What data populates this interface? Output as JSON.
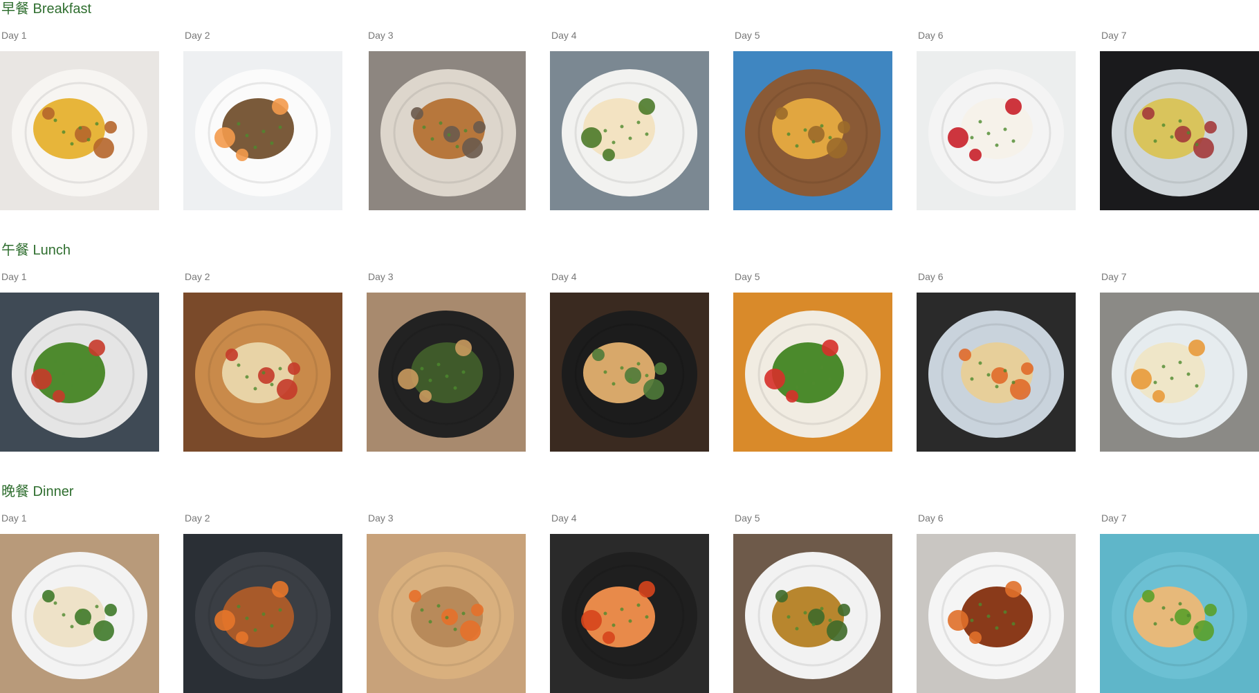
{
  "meals": [
    {
      "key": "breakfast",
      "title": "早餐 Breakfast",
      "days": [
        {
          "label": "Day 1",
          "photo": "fried-potatoes-scrambled-eggs-photo",
          "bg": "#e9e6e3",
          "plate": "#f7f5f2",
          "food": "#e7b53a",
          "accent": "#b5662b"
        },
        {
          "label": "Day 2",
          "photo": "muesli-peach-bowl-photo",
          "bg": "#eef0f2",
          "plate": "#fbfbfb",
          "food": "#7a5a3a",
          "accent": "#f39a4c"
        },
        {
          "label": "Day 3",
          "photo": "croissant-on-tray-photo",
          "bg": "#8d8680",
          "plate": "#ddd6cc",
          "food": "#b7773c",
          "accent": "#6a5a4d"
        },
        {
          "label": "Day 4",
          "photo": "eggs-benedict-avocado-photo",
          "bg": "#7b8892",
          "plate": "#f2f2f0",
          "food": "#f3e3c2",
          "accent": "#4d7a2a"
        },
        {
          "label": "Day 5",
          "photo": "grilled-sandwich-photo",
          "bg": "#3f86c1",
          "plate": "#8a5a36",
          "food": "#e1a640",
          "accent": "#9b6a2a"
        },
        {
          "label": "Day 6",
          "photo": "yogurt-berry-jar-photo",
          "bg": "#eceeee",
          "plate": "#f4f4f4",
          "food": "#f6f2ea",
          "accent": "#c9202a"
        },
        {
          "label": "Day 7",
          "photo": "omelette-pan-vegetables-photo",
          "bg": "#1a1a1c",
          "plate": "#cfd6da",
          "food": "#d9c45c",
          "accent": "#a33a3a"
        }
      ]
    },
    {
      "key": "lunch",
      "title": "午餐 Lunch",
      "days": [
        {
          "label": "Day 1",
          "photo": "green-salad-bread-photo",
          "bg": "#3f4a55",
          "plate": "#e5e5e5",
          "food": "#4e8a2e",
          "accent": "#c63a2a"
        },
        {
          "label": "Day 2",
          "photo": "chicken-burrito-wrap-photo",
          "bg": "#7a4a2a",
          "plate": "#c98a4a",
          "food": "#e8d3a6",
          "accent": "#c43a2a"
        },
        {
          "label": "Day 3",
          "photo": "shakshuka-pan-toast-photo",
          "bg": "#a88a6e",
          "plate": "#222222",
          "food": "#3f5a2a",
          "accent": "#c99a5e"
        },
        {
          "label": "Day 4",
          "photo": "bagel-sandwich-dark-plate-photo",
          "bg": "#3a2a20",
          "plate": "#1c1c1c",
          "food": "#d8a86a",
          "accent": "#4f7a3a"
        },
        {
          "label": "Day 5",
          "photo": "tomato-avocado-corn-plate-photo",
          "bg": "#d98a2a",
          "plate": "#f1ece2",
          "food": "#4b8a2c",
          "accent": "#d6302a"
        },
        {
          "label": "Day 6",
          "photo": "noodle-soup-bowl-photo",
          "bg": "#2a2a2a",
          "plate": "#c9d3dc",
          "food": "#e7cf9a",
          "accent": "#e06a2a"
        },
        {
          "label": "Day 7",
          "photo": "rice-salad-plates-photo",
          "bg": "#8b8a86",
          "plate": "#e6ecef",
          "food": "#efe6c8",
          "accent": "#e89a3a"
        }
      ]
    },
    {
      "key": "dinner",
      "title": "晚餐 Dinner",
      "days": [
        {
          "label": "Day 1",
          "photo": "pho-noodle-soup-photo",
          "bg": "#b89a7a",
          "plate": "#f3f3f3",
          "food": "#eee2c8",
          "accent": "#3f7a2a"
        },
        {
          "label": "Day 2",
          "photo": "sesame-chicken-salad-photo",
          "bg": "#2a2f35",
          "plate": "#3a3e44",
          "food": "#a85a2a",
          "accent": "#e6762a"
        },
        {
          "label": "Day 3",
          "photo": "grilled-chicken-vegetables-photo",
          "bg": "#c8a27a",
          "plate": "#d9b07e",
          "food": "#b88a5a",
          "accent": "#e5702a"
        },
        {
          "label": "Day 4",
          "photo": "grilled-salmon-peppers-photo",
          "bg": "#2a2a2a",
          "plate": "#1f1f1f",
          "food": "#e88a4a",
          "accent": "#d6441c"
        },
        {
          "label": "Day 5",
          "photo": "stir-fried-noodles-photo",
          "bg": "#6e5a4a",
          "plate": "#f2f2f2",
          "food": "#b8862e",
          "accent": "#3f6a2a"
        },
        {
          "label": "Day 6",
          "photo": "shrimp-curry-rice-photo",
          "bg": "#c9c6c2",
          "plate": "#f5f5f5",
          "food": "#8a3a1a",
          "accent": "#e0702a"
        },
        {
          "label": "Day 7",
          "photo": "fish-fillet-vegetable-plate-photo",
          "bg": "#5fb6c9",
          "plate": "#6cc0d3",
          "food": "#e7b97a",
          "accent": "#5aa02a"
        }
      ]
    }
  ]
}
